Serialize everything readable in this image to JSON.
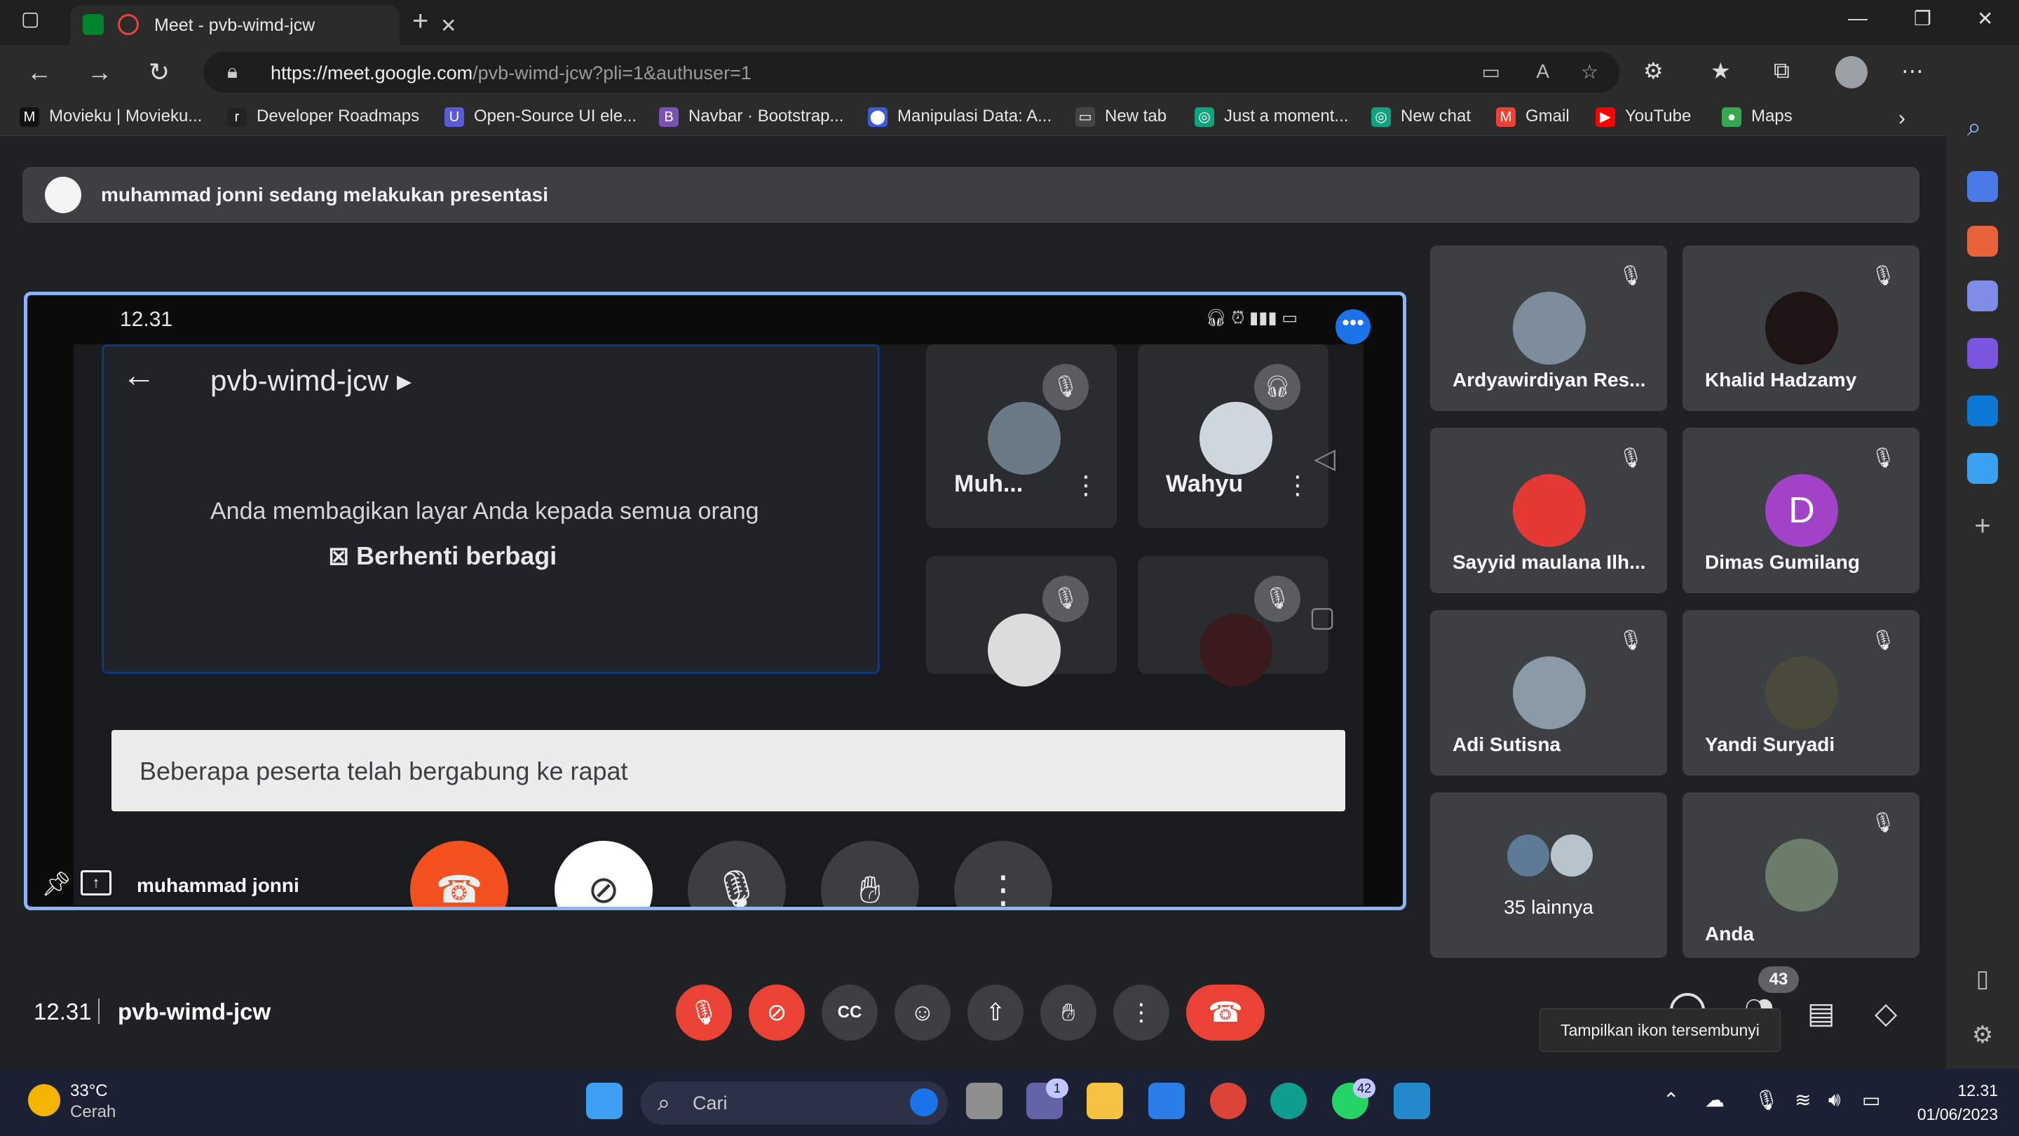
{
  "browser": {
    "tab_title": "Meet - pvb-wimd-jcw",
    "url_host": "https://meet.google.com",
    "url_path": "/pvb-wimd-jcw?pli=1&authuser=1",
    "bookmarks": [
      {
        "label": "Movieku | Movieku...",
        "icon": "M",
        "color": "#111111"
      },
      {
        "label": "Developer Roadmaps",
        "icon": "r",
        "color": "#222222"
      },
      {
        "label": "Open-Source UI ele...",
        "icon": "U",
        "color": "#5b5bd6"
      },
      {
        "label": "Navbar · Bootstrap...",
        "icon": "B",
        "color": "#7952b3"
      },
      {
        "label": "Manipulasi Data: A...",
        "icon": "⬤",
        "color": "#3b5bdb"
      },
      {
        "label": "New tab",
        "icon": "▭",
        "color": "#444444"
      },
      {
        "label": "Just a moment...",
        "icon": "◎",
        "color": "#10a37f"
      },
      {
        "label": "New chat",
        "icon": "◎",
        "color": "#10a37f"
      },
      {
        "label": "Gmail",
        "icon": "M",
        "color": "#ea4335"
      },
      {
        "label": "YouTube",
        "icon": "▶",
        "color": "#ff0000"
      },
      {
        "label": "Maps",
        "icon": "●",
        "color": "#34a853"
      }
    ]
  },
  "meet": {
    "banner_text": "muhammad jonni sedang melakukan presentasi",
    "presenter_name": "muhammad jonni",
    "phone": {
      "time": "12.31",
      "meeting_code": "pvb-wimd-jcw",
      "share_message": "Anda membagikan layar Anda kepada semua orang",
      "stop_label": "Berhenti berbagi",
      "toast": "Beberapa peserta telah bergabung ke rapat",
      "tiles": [
        {
          "name": "Muh...",
          "mic": "muted"
        },
        {
          "name": "Wahyu",
          "mic": "headset"
        },
        {
          "name": "",
          "mic": "muted"
        },
        {
          "name": "",
          "mic": "muted"
        }
      ]
    },
    "participants": [
      {
        "name": "Ardyawirdiyan Res...",
        "avatar_color": "#7d8d9c",
        "initial": ""
      },
      {
        "name": "Khalid Hadzamy",
        "avatar_color": "#1e1414",
        "initial": ""
      },
      {
        "name": "Sayyid maulana Ilh...",
        "avatar_color": "#e53935",
        "initial": ""
      },
      {
        "name": "Dimas Gumilang",
        "avatar_color": "#a142c8",
        "initial": "D"
      },
      {
        "name": "Adi Sutisna",
        "avatar_color": "#8a9aa6",
        "initial": ""
      },
      {
        "name": "Yandi Suryadi",
        "avatar_color": "#4a4a3a",
        "initial": ""
      },
      {
        "name": "35 lainnya",
        "avatar_color": "#5d7a98",
        "initial": ""
      },
      {
        "name": "Anda",
        "avatar_color": "#6d7b6a",
        "initial": ""
      }
    ],
    "bottom_time": "12.31",
    "bottom_code": "pvb-wimd-jcw",
    "people_count": "43",
    "tooltip": "Tampilkan ikon tersembunyi"
  },
  "taskbar": {
    "temperature": "33°C",
    "weather": "Cerah",
    "search_placeholder": "Cari",
    "time": "12.31",
    "date": "01/06/2023",
    "teams_badge": "1",
    "whatsapp_badge": "42"
  }
}
